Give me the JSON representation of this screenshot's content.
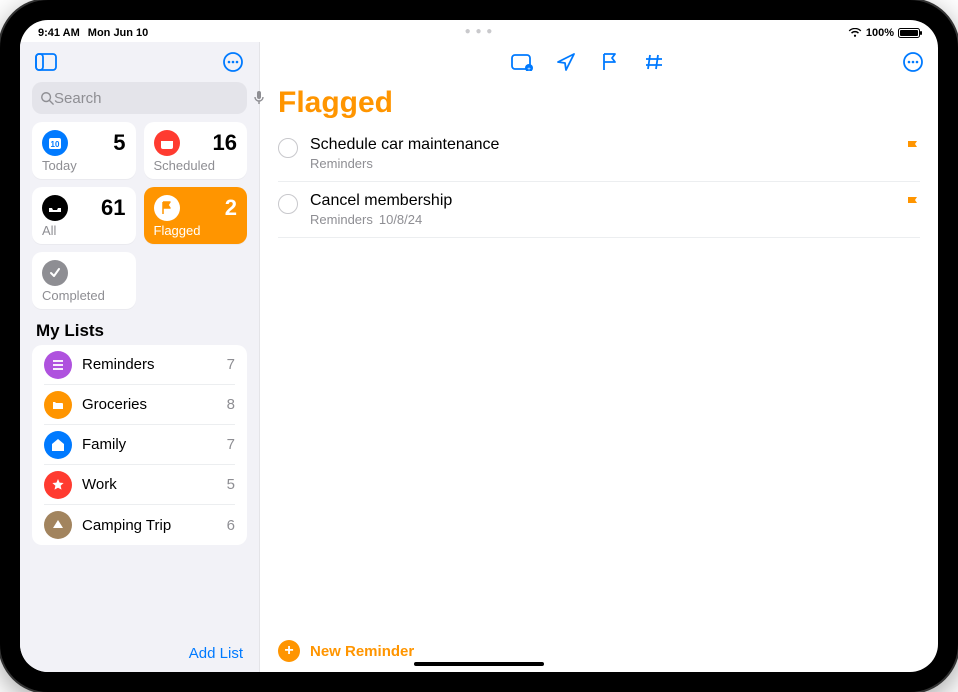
{
  "status": {
    "time": "9:41 AM",
    "date": "Mon Jun 10",
    "battery": "100%"
  },
  "search": {
    "placeholder": "Search"
  },
  "smart": {
    "today": {
      "label": "Today",
      "count": "5"
    },
    "scheduled": {
      "label": "Scheduled",
      "count": "16"
    },
    "all": {
      "label": "All",
      "count": "61"
    },
    "flagged": {
      "label": "Flagged",
      "count": "2"
    },
    "completed": {
      "label": "Completed"
    }
  },
  "lists_header": "My Lists",
  "lists": [
    {
      "name": "Reminders",
      "count": "7",
      "color": "lc-purple"
    },
    {
      "name": "Groceries",
      "count": "8",
      "color": "lc-orange"
    },
    {
      "name": "Family",
      "count": "7",
      "color": "lc-blue"
    },
    {
      "name": "Work",
      "count": "5",
      "color": "lc-red"
    },
    {
      "name": "Camping Trip",
      "count": "6",
      "color": "lc-brown"
    }
  ],
  "add_list_label": "Add List",
  "main": {
    "title": "Flagged",
    "reminders": [
      {
        "title": "Schedule car maintenance",
        "list": "Reminders",
        "date": ""
      },
      {
        "title": "Cancel membership",
        "list": "Reminders",
        "date": "10/8/24"
      }
    ],
    "new_reminder_label": "New Reminder"
  }
}
